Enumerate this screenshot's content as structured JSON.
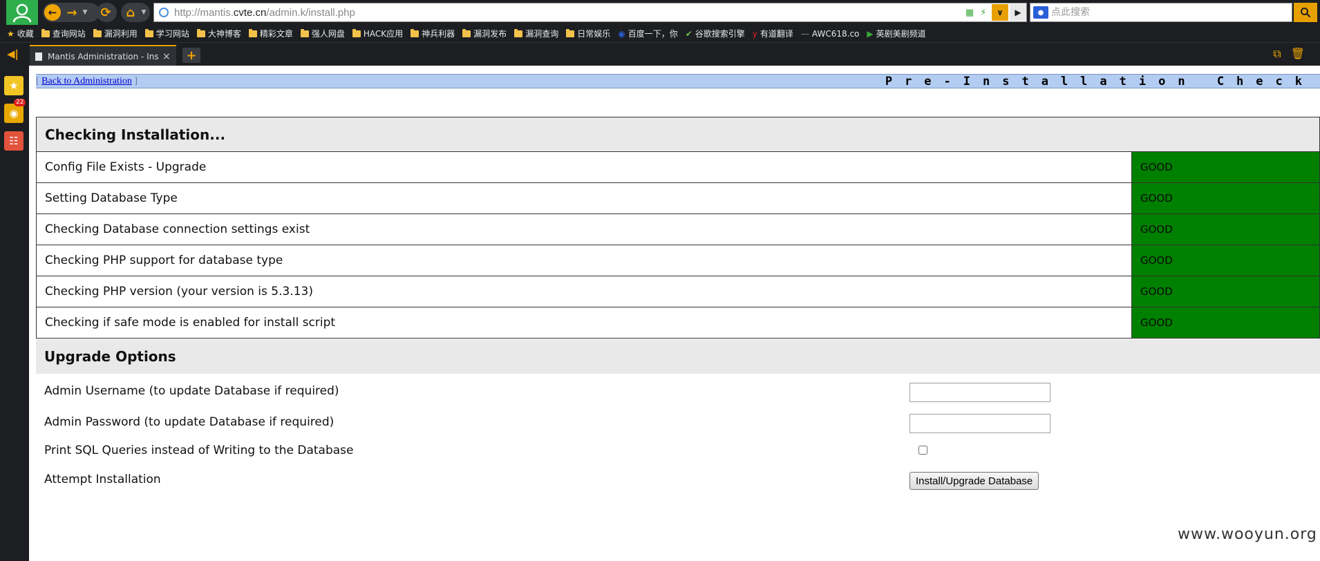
{
  "browser": {
    "url_prefix": "http://mantis.",
    "url_domain": "cvte.cn",
    "url_path": "/admin.k/install.php",
    "search_placeholder": "点此搜索",
    "search_engine_icon": "baidu-paw-icon",
    "tab_title": "Mantis Administration - Ins",
    "tab_close": "×",
    "new_tab": "+",
    "badge_count": "22",
    "accent_color": "#f0a500",
    "bookmarks": [
      {
        "icon": "star-icon",
        "label": "收藏"
      },
      {
        "icon": "folder-icon",
        "label": "查询网站"
      },
      {
        "icon": "folder-icon",
        "label": "漏洞利用"
      },
      {
        "icon": "folder-icon",
        "label": "学习网站"
      },
      {
        "icon": "folder-icon",
        "label": "大神博客"
      },
      {
        "icon": "folder-icon",
        "label": "精彩文章"
      },
      {
        "icon": "folder-icon",
        "label": "强人网盘"
      },
      {
        "icon": "folder-icon",
        "label": "HACK应用"
      },
      {
        "icon": "folder-icon",
        "label": "神兵利器"
      },
      {
        "icon": "folder-icon",
        "label": "漏洞发布"
      },
      {
        "icon": "folder-icon",
        "label": "漏洞查询"
      },
      {
        "icon": "folder-icon",
        "label": "日常娱乐"
      },
      {
        "icon": "baidu-icon",
        "label": "百度一下，你"
      },
      {
        "icon": "google-icon",
        "label": "谷歌搜索引擎"
      },
      {
        "icon": "youdao-icon",
        "label": "有道翻译"
      },
      {
        "icon": "dash-icon",
        "label": "AWC618.co"
      },
      {
        "icon": "play-icon",
        "label": "英剧美剧频道"
      }
    ]
  },
  "page": {
    "back_link": "Back to Administration",
    "bracket_open": "[",
    "bracket_close": "]",
    "title": "Pre-Installation Check",
    "checks_heading": "Checking Installation...",
    "good_color": "#008000",
    "checks": [
      {
        "label": "Config File Exists - Upgrade",
        "status": "GOOD"
      },
      {
        "label": "Setting Database Type",
        "status": "GOOD"
      },
      {
        "label": "Checking Database connection settings exist",
        "status": "GOOD"
      },
      {
        "label": "Checking PHP support for database type",
        "status": "GOOD"
      },
      {
        "label": "Checking PHP version (your version is 5.3.13)",
        "status": "GOOD"
      },
      {
        "label": "Checking if safe mode is enabled for install script",
        "status": "GOOD"
      }
    ],
    "options_heading": "Upgrade Options",
    "admin_username_label": "Admin Username (to update Database if required)",
    "admin_username_value": "",
    "admin_password_label": "Admin Password (to update Database if required)",
    "admin_password_value": "",
    "print_sql_label": "Print SQL Queries instead of Writing to the Database",
    "print_sql_checked": false,
    "attempt_label": "Attempt Installation",
    "install_button": "Install/Upgrade Database"
  },
  "watermark": "www.wooyun.org"
}
